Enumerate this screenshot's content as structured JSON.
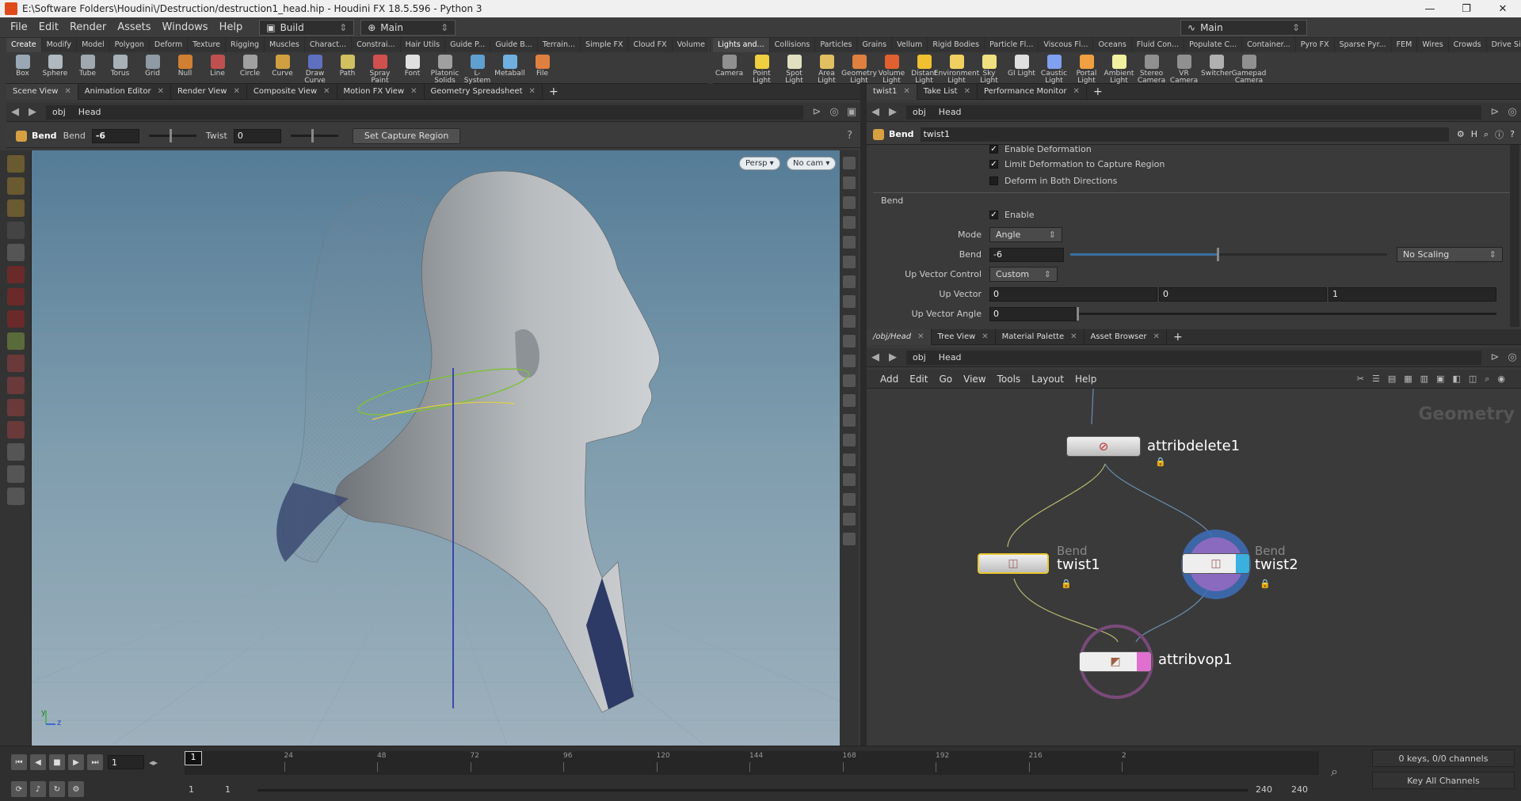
{
  "window": {
    "title": "E:\\Software Folders\\Houdini\\/Destruction/destruction1_head.hip - Houdini FX 18.5.596 - Python 3",
    "controls": [
      "—",
      "❐",
      "✕"
    ]
  },
  "menu": [
    "File",
    "Edit",
    "Render",
    "Assets",
    "Windows",
    "Help"
  ],
  "desktop_left": "Build",
  "desktop_center": "Main",
  "desktop_right": "Main",
  "shelf_tabs_left": [
    "Create",
    "Modify",
    "Model",
    "Polygon",
    "Deform",
    "Texture",
    "Rigging",
    "Muscles",
    "Charact...",
    "Constrai...",
    "Hair Utils",
    "Guide P...",
    "Guide B...",
    "Terrain...",
    "Simple FX",
    "Cloud FX",
    "Volume"
  ],
  "shelf_tabs_right": [
    "Lights and...",
    "Collisions",
    "Particles",
    "Grains",
    "Vellum",
    "Rigid Bodies",
    "Particle Fl...",
    "Viscous Fl...",
    "Oceans",
    "Fluid Con...",
    "Populate C...",
    "Container...",
    "Pyro FX",
    "Sparse Pyr...",
    "FEM",
    "Wires",
    "Crowds",
    "Drive Sim..."
  ],
  "tools_left": [
    {
      "label": "Box",
      "color": "#9aa7b4"
    },
    {
      "label": "Sphere",
      "color": "#b0b8c0"
    },
    {
      "label": "Tube",
      "color": "#a0a8b0"
    },
    {
      "label": "Torus",
      "color": "#a8b0b8"
    },
    {
      "label": "Grid",
      "color": "#909aa4"
    },
    {
      "label": "Null",
      "color": "#d08030"
    },
    {
      "label": "Line",
      "color": "#c05050"
    },
    {
      "label": "Circle",
      "color": "#a0a0a0"
    },
    {
      "label": "Curve",
      "color": "#d0a040"
    },
    {
      "label": "Draw Curve",
      "color": "#6070c0"
    },
    {
      "label": "Path",
      "color": "#d0c060"
    },
    {
      "label": "Spray Paint",
      "color": "#d05050"
    },
    {
      "label": "Font",
      "color": "#e0e0e0"
    },
    {
      "label": "Platonic Solids",
      "color": "#a0a0a0"
    },
    {
      "label": "L-System",
      "color": "#60a0d0"
    },
    {
      "label": "Metaball",
      "color": "#70b0e0"
    },
    {
      "label": "File",
      "color": "#e08040"
    }
  ],
  "tools_right": [
    {
      "label": "Camera",
      "color": "#909090"
    },
    {
      "label": "Point Light",
      "color": "#f0d040"
    },
    {
      "label": "Spot Light",
      "color": "#e0e0c0"
    },
    {
      "label": "Area Light",
      "color": "#e0c060"
    },
    {
      "label": "Geometry Light",
      "color": "#e08040"
    },
    {
      "label": "Volume Light",
      "color": "#e06030"
    },
    {
      "label": "Distant Light",
      "color": "#f0c030"
    },
    {
      "label": "Environment Light",
      "color": "#f0d060"
    },
    {
      "label": "Sky Light",
      "color": "#f0e080"
    },
    {
      "label": "GI Light",
      "color": "#e0e0e0"
    },
    {
      "label": "Caustic Light",
      "color": "#80a0f0"
    },
    {
      "label": "Portal Light",
      "color": "#f0a040"
    },
    {
      "label": "Ambient Light",
      "color": "#f0f0a0"
    },
    {
      "label": "Stereo Camera",
      "color": "#909090"
    },
    {
      "label": "VR Camera",
      "color": "#909090"
    },
    {
      "label": "Switcher",
      "color": "#b0b0b0"
    },
    {
      "label": "Gamepad Camera",
      "color": "#909090"
    }
  ],
  "left_pane": {
    "tabs": [
      "Scene View",
      "Animation Editor",
      "Render View",
      "Composite View",
      "Motion FX View",
      "Geometry Spreadsheet"
    ],
    "path": [
      "obj",
      "Head"
    ]
  },
  "operation": {
    "label1": "Bend",
    "label2": "Bend",
    "bend_value": "-6",
    "twist_label": "Twist",
    "twist_value": "0",
    "capture_button": "Set Capture Region"
  },
  "viewport": {
    "persp": "Persp ▾",
    "cam": "No cam ▾",
    "axis_y": "y",
    "axis_z": "z"
  },
  "params": {
    "tabs": [
      "twist1",
      "Take List",
      "Performance Monitor"
    ],
    "path": [
      "obj",
      "Head"
    ],
    "node_type": "Bend",
    "node_name": "twist1",
    "opt_enable_def": "Enable Deformation",
    "opt_limit": "Limit Deformation to Capture Region",
    "opt_both": "Deform in Both Directions",
    "section": "Bend",
    "enable": "Enable",
    "mode_label": "Mode",
    "mode": "Angle",
    "bend_label": "Bend",
    "bend": "-6",
    "scaling": "No Scaling",
    "upctrl_label": "Up Vector Control",
    "upctrl": "Custom",
    "upvec_label": "Up Vector",
    "upvec": [
      "0",
      "0",
      "1"
    ],
    "upangle_label": "Up Vector Angle",
    "upangle": "0"
  },
  "network": {
    "tabs": [
      "/obj/Head",
      "Tree View",
      "Material Palette",
      "Asset Browser"
    ],
    "path": [
      "obj",
      "Head"
    ],
    "menu": [
      "Add",
      "Edit",
      "Go",
      "View",
      "Tools",
      "Layout",
      "Help"
    ],
    "context": "Geometry",
    "nodes": {
      "attribdelete": "attribdelete1",
      "bend1_type": "Bend",
      "bend1": "twist1",
      "bend2_type": "Bend",
      "bend2": "twist2",
      "vop": "attribvop1"
    }
  },
  "timeline": {
    "frame": "1",
    "ticks": [
      "24",
      "48",
      "72",
      "96",
      "120",
      "144",
      "168",
      "192",
      "216",
      "2"
    ],
    "current_mark": "1",
    "start": "1",
    "start2": "1",
    "end": "240",
    "end2": "240",
    "keys": "0 keys, 0/0 channels",
    "key_all": "Key All Channels"
  }
}
